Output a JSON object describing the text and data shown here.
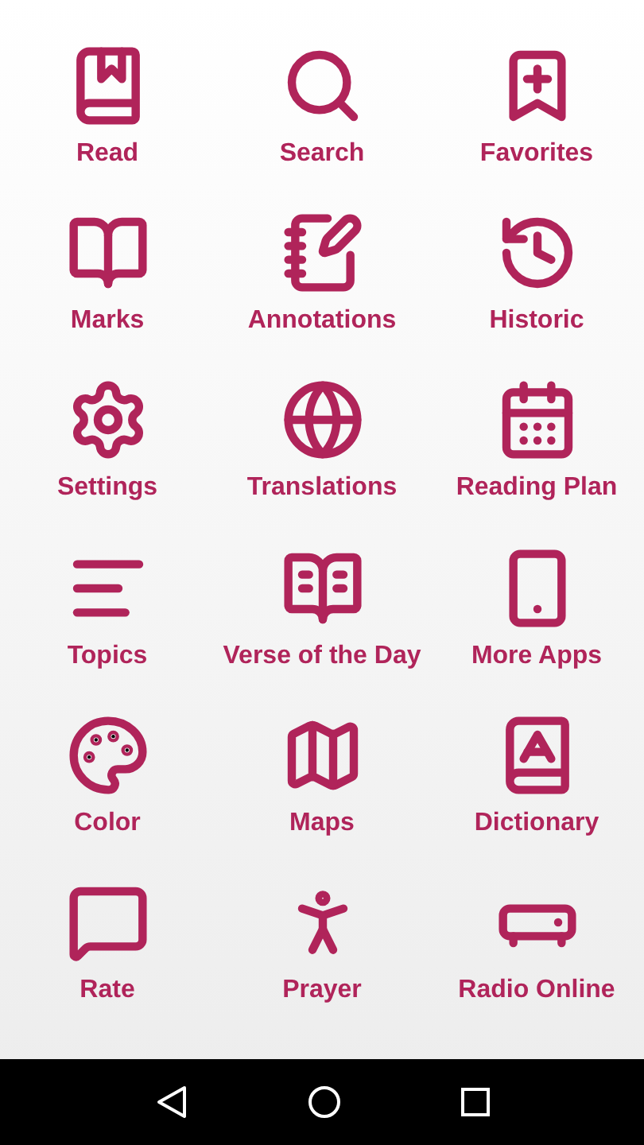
{
  "menu": [
    {
      "label": "Read"
    },
    {
      "label": "Search"
    },
    {
      "label": "Favorites"
    },
    {
      "label": "Marks"
    },
    {
      "label": "Annotations"
    },
    {
      "label": "Historic"
    },
    {
      "label": "Settings"
    },
    {
      "label": "Translations"
    },
    {
      "label": "Reading Plan"
    },
    {
      "label": "Topics"
    },
    {
      "label": "Verse of the Day"
    },
    {
      "label": "More Apps"
    },
    {
      "label": "Color"
    },
    {
      "label": "Maps"
    },
    {
      "label": "Dictionary"
    },
    {
      "label": "Rate"
    },
    {
      "label": "Prayer"
    },
    {
      "label": "Radio Online"
    }
  ]
}
